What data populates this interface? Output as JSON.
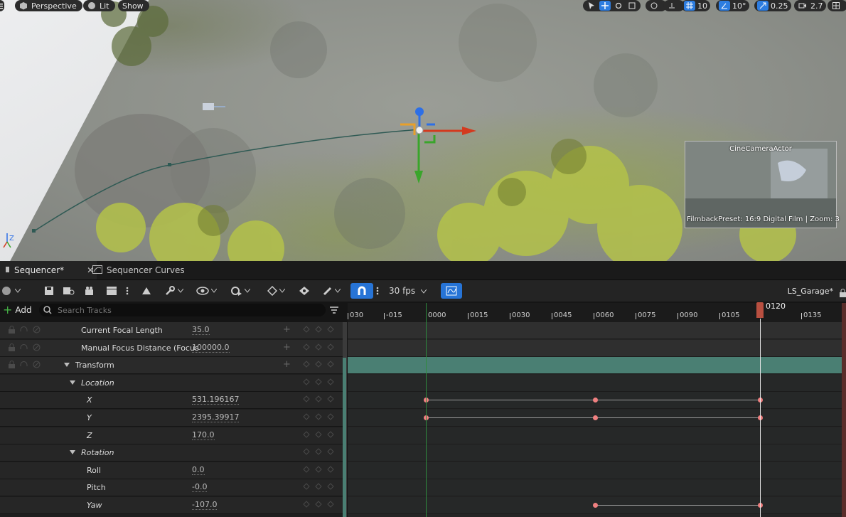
{
  "viewport": {
    "pills": [
      {
        "name": "viewport-mode",
        "label": "Perspective"
      },
      {
        "name": "lighting-mode",
        "label": "Lit"
      },
      {
        "name": "show-menu",
        "label": "Show"
      }
    ],
    "grid_snap_value": "10",
    "angle_snap_value": "10°",
    "scale_snap_value": "0.25",
    "camera_speed_value": "2.7",
    "pip": {
      "title": "CineCameraActor",
      "subtitle": "FilmbackPreset: 16:9 Digital Film | Zoom: 3"
    }
  },
  "tabs": [
    {
      "label": "Sequencer*",
      "active": true
    },
    {
      "label": "Sequencer Curves",
      "active": false
    }
  ],
  "toolbar": {
    "fps_label": "30 fps",
    "sequence_name": "LS_Garage*"
  },
  "search": {
    "add_label": "Add",
    "placeholder": "Search Tracks"
  },
  "tracks": [
    {
      "label": "Current Focal Length",
      "value": "35.0",
      "indent": 114,
      "style": "d1",
      "lock": true,
      "plus": true
    },
    {
      "label": "Manual Focus Distance (Focus",
      "value": "100000.0",
      "indent": 114,
      "style": "d1",
      "lock": true,
      "plus": true
    },
    {
      "label": "Transform",
      "value": "",
      "indent": 106,
      "style": "d1",
      "lock": true,
      "plus": true,
      "expander": true
    },
    {
      "label": "Location",
      "value": "",
      "indent": 114,
      "style": "d2",
      "italic": true,
      "expander": true
    },
    {
      "label": "X",
      "value": "531.196167",
      "indent": 122,
      "style": "d2",
      "italic": true
    },
    {
      "label": "Y",
      "value": "2395.39917",
      "indent": 122,
      "style": "d2",
      "italic": true
    },
    {
      "label": "Z",
      "value": "170.0",
      "indent": 122,
      "style": "d2",
      "italic": true
    },
    {
      "label": "Rotation",
      "value": "",
      "indent": 114,
      "style": "d2",
      "italic": true,
      "expander": true
    },
    {
      "label": "Roll",
      "value": "0.0",
      "indent": 122,
      "style": "d2"
    },
    {
      "label": "Pitch",
      "value": "-0.0",
      "indent": 122,
      "style": "d2"
    },
    {
      "label": "Yaw",
      "value": "-107.0",
      "indent": 122,
      "style": "d2",
      "italic": true
    }
  ],
  "ruler": {
    "frames": [
      "030",
      "-015",
      "0000",
      "0015",
      "0030",
      "0045",
      "0060",
      "0075",
      "0090",
      "0105",
      "0135"
    ],
    "playhead": "0120"
  },
  "colors": {
    "accent": "#2774d6",
    "key": "#f08080",
    "playhead": "#b84f40",
    "transform_row": "#4a7f73"
  }
}
